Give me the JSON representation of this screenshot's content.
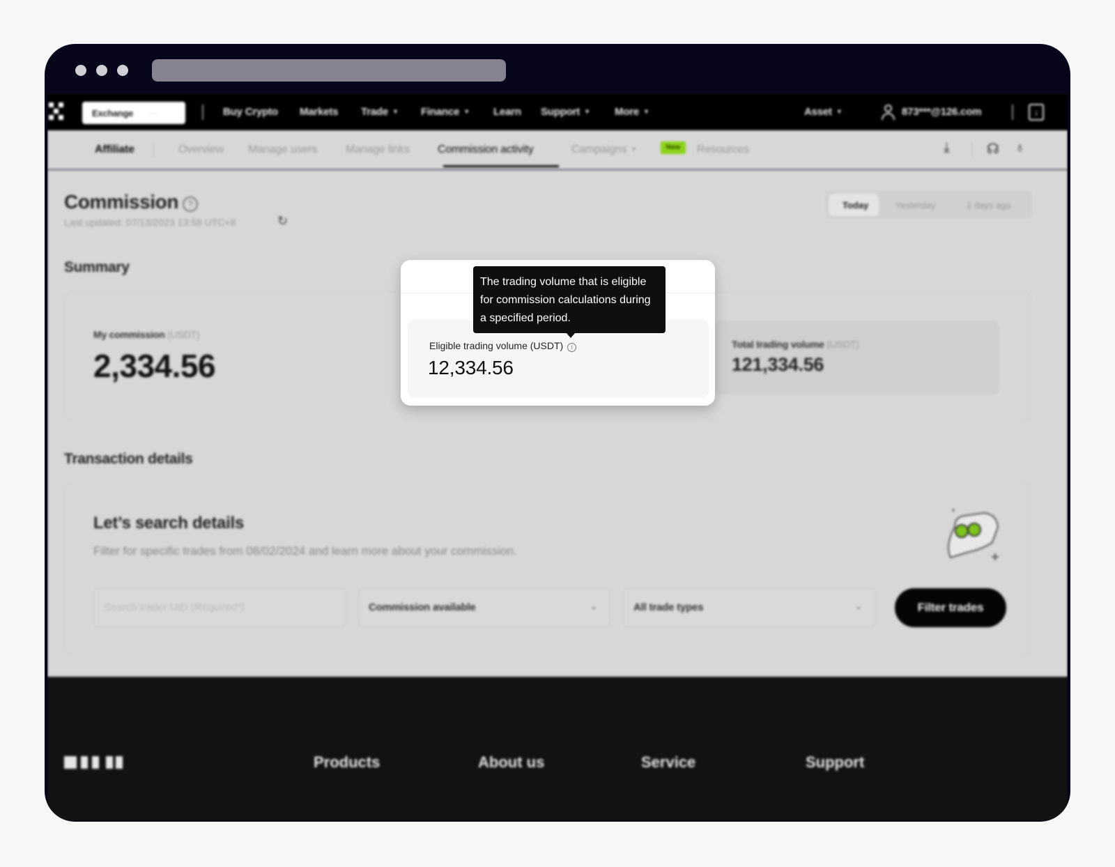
{
  "topnav": {
    "exchange_label": "Exchange",
    "items": [
      "Buy Crypto",
      "Markets",
      "Trade",
      "Finance",
      "Learn",
      "Support",
      "More"
    ],
    "asset_label": "Asset",
    "user_email": "873***@126.com"
  },
  "subnav": {
    "brand": "Affiliate",
    "items": [
      "Overview",
      "Manage users",
      "Manage links",
      "Commission activity",
      "Campaigns",
      "Resources"
    ],
    "active": "Commission activity",
    "new_badge": "New"
  },
  "header": {
    "title": "Commission",
    "last_updated": "Last updated: 07/13/2023 13:58 UTC+8",
    "range_options": [
      "Today",
      "Yesterday",
      "2 days ago"
    ],
    "range_selected": "Today"
  },
  "summary": {
    "heading": "Summary",
    "my_commission": {
      "label": "My commission",
      "unit": "(USDT)",
      "value": "2,334.56"
    },
    "eligible_volume": {
      "label": "Eligible trading volume (USDT)",
      "value": "12,334.56"
    },
    "total_volume": {
      "label": "Total trading volume",
      "unit": "(USDT)",
      "value": "121,334.56"
    }
  },
  "tooltip": {
    "text": "The trading volume that is eligible for commission calculations during a specified period."
  },
  "transactions": {
    "heading": "Transaction details",
    "search_title": "Let’s search details",
    "search_subtitle": "Filter for specific trades from 08/02/2024 and learn more about your commission.",
    "uid_placeholder": "Search trader UID (Required*)",
    "commission_select": "Commission available",
    "trade_type_select": "All trade types",
    "filter_button": "Filter trades"
  },
  "footer": {
    "columns": [
      "Products",
      "About us",
      "Service",
      "Support"
    ]
  },
  "colors": {
    "accent_green": "#8bd317",
    "dark": "#050505",
    "window_frame": "#07051a"
  }
}
